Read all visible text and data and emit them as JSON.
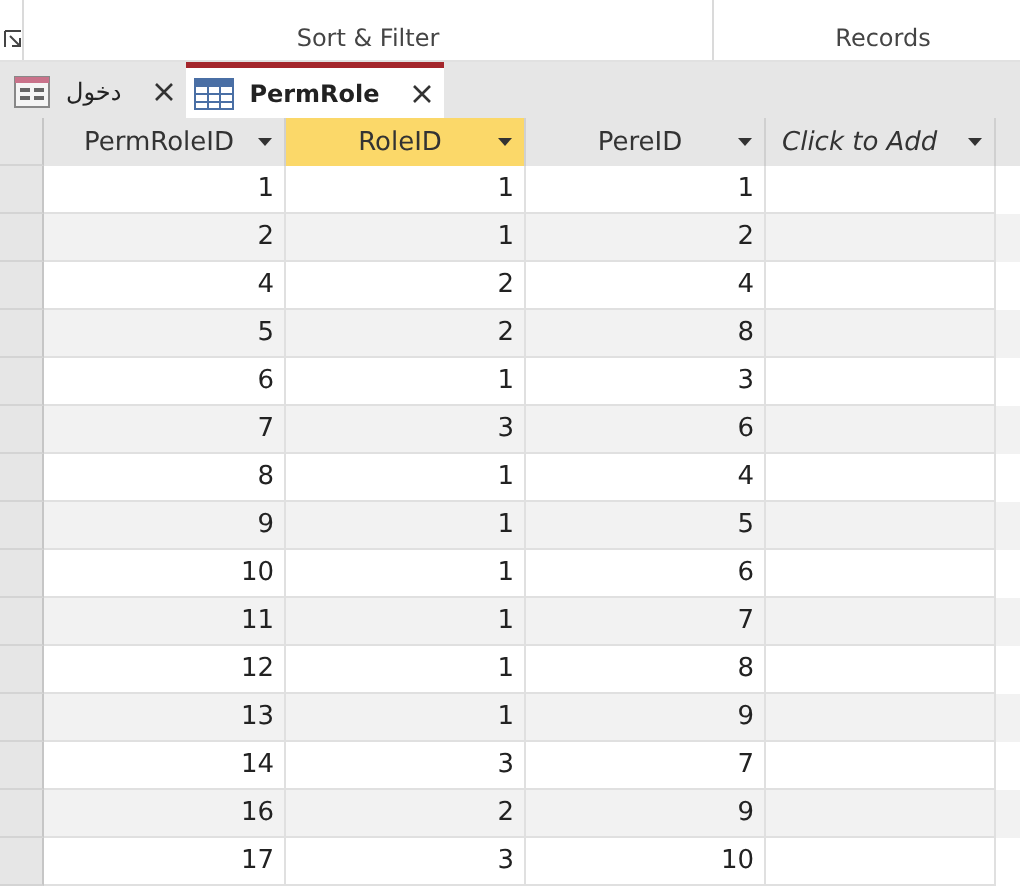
{
  "ribbon": {
    "groups": [
      {
        "label": "Sort & Filter"
      },
      {
        "label": "Records"
      }
    ]
  },
  "tabs": [
    {
      "label": "دخول",
      "kind": "form",
      "selected": false
    },
    {
      "label": "PermRole",
      "kind": "table",
      "selected": true
    }
  ],
  "table": {
    "columns": [
      {
        "label": "PermRoleID",
        "selected": false,
        "kind": "field"
      },
      {
        "label": "RoleID",
        "selected": true,
        "kind": "field"
      },
      {
        "label": "PereID",
        "selected": false,
        "kind": "field"
      },
      {
        "label": "Click to Add",
        "selected": false,
        "kind": "add"
      }
    ],
    "rows": [
      [
        "1",
        "1",
        "1"
      ],
      [
        "2",
        "1",
        "2"
      ],
      [
        "4",
        "2",
        "4"
      ],
      [
        "5",
        "2",
        "8"
      ],
      [
        "6",
        "1",
        "3"
      ],
      [
        "7",
        "3",
        "6"
      ],
      [
        "8",
        "1",
        "4"
      ],
      [
        "9",
        "1",
        "5"
      ],
      [
        "10",
        "1",
        "6"
      ],
      [
        "11",
        "1",
        "7"
      ],
      [
        "12",
        "1",
        "8"
      ],
      [
        "13",
        "1",
        "9"
      ],
      [
        "14",
        "3",
        "7"
      ],
      [
        "16",
        "2",
        "9"
      ],
      [
        "17",
        "3",
        "10"
      ]
    ]
  }
}
